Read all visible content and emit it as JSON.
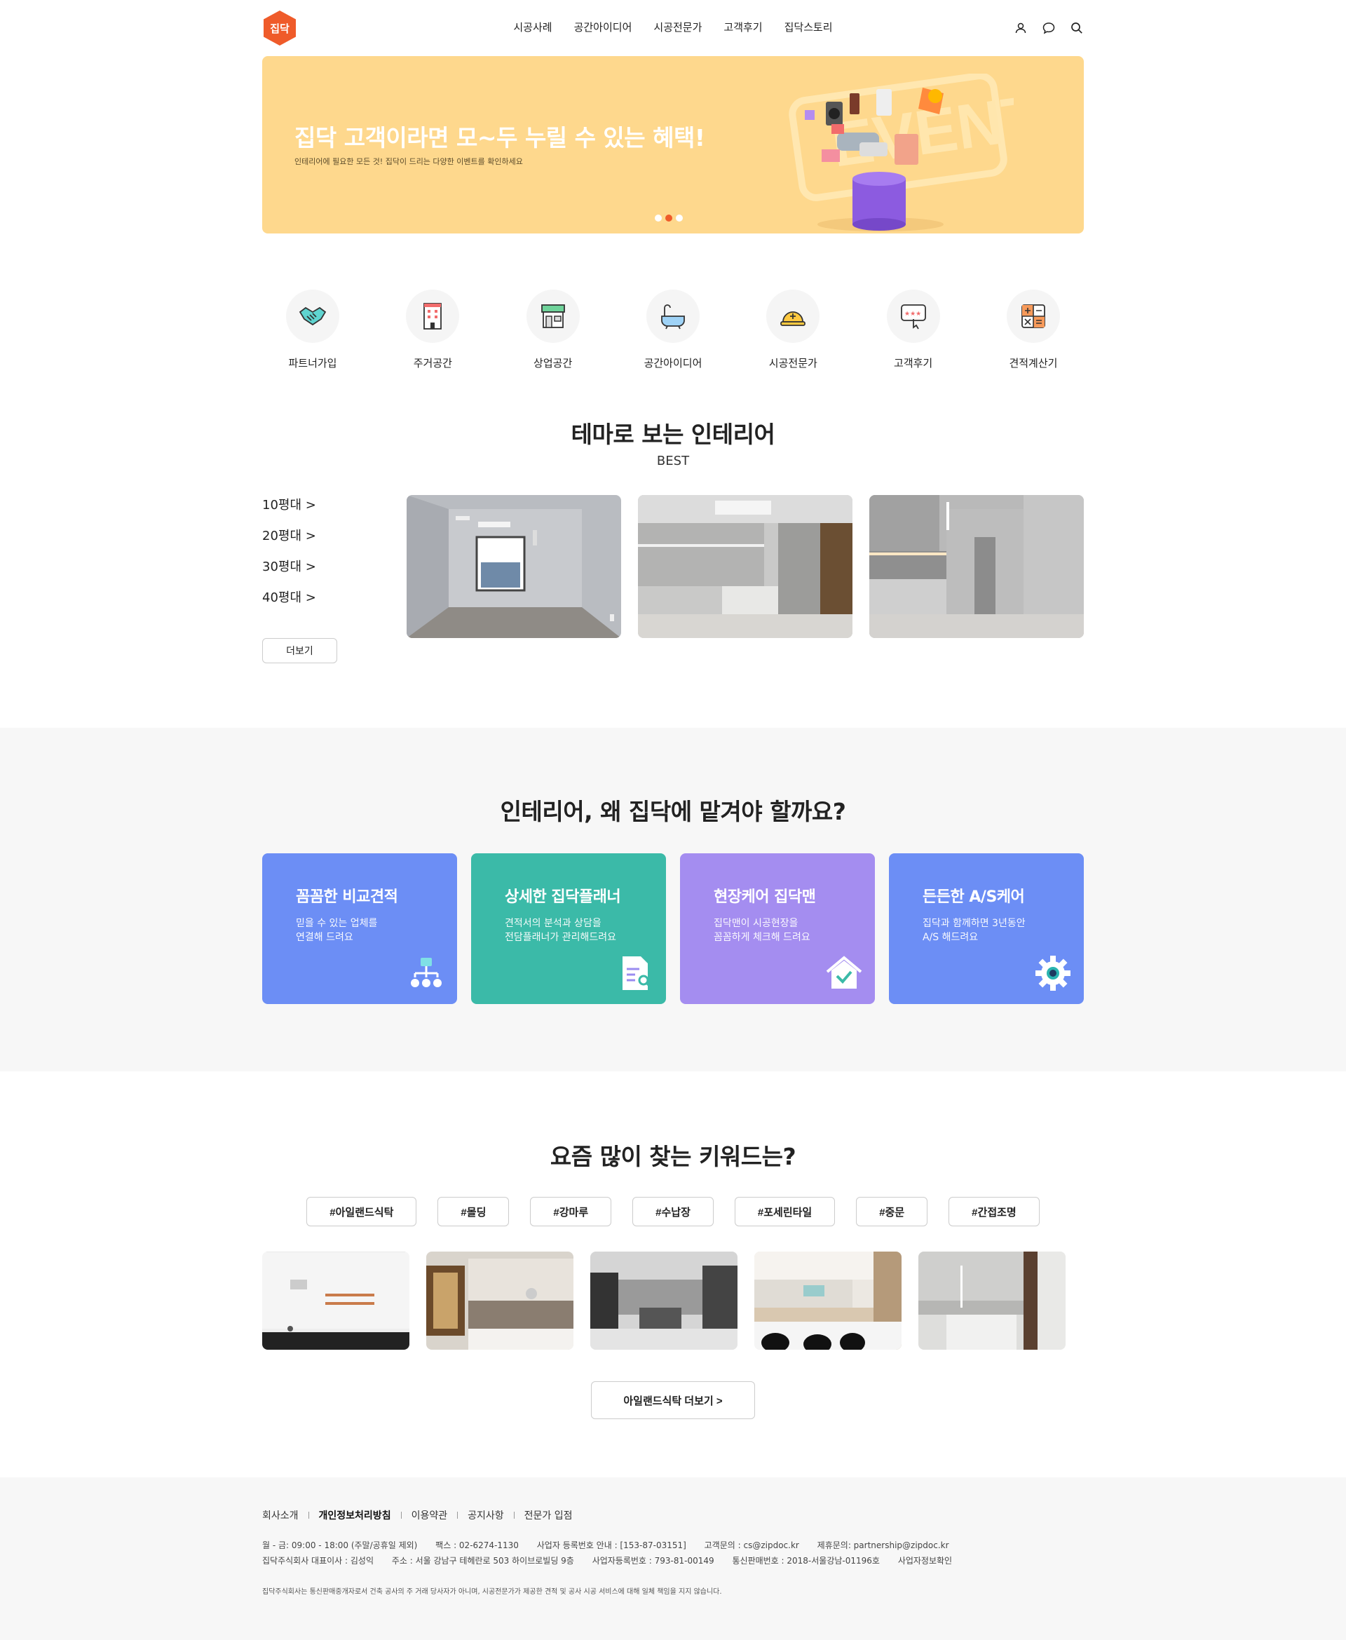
{
  "header": {
    "logo_text": "집닥",
    "nav": [
      "시공사례",
      "공간아이디어",
      "시공전문가",
      "고객후기",
      "집닥스토리"
    ],
    "icons": [
      "user-icon",
      "chat-icon",
      "search-icon"
    ]
  },
  "banner": {
    "title": "집닥 고객이라면 모~두 누릴 수 있는 혜택!",
    "subtitle": "인테리어에 필요한 모든 것! 집닥이 드리는 다양한 이벤트를 확인하세요",
    "slide_count": 3,
    "active_slide": 2,
    "bg_color": "#fed88d"
  },
  "quick_menu": [
    {
      "label": "파트너가입",
      "icon": "handshake-icon"
    },
    {
      "label": "주거공간",
      "icon": "building-icon"
    },
    {
      "label": "상업공간",
      "icon": "store-icon"
    },
    {
      "label": "공간아이디어",
      "icon": "bathtub-icon"
    },
    {
      "label": "시공전문가",
      "icon": "helmet-icon"
    },
    {
      "label": "고객후기",
      "icon": "review-icon"
    },
    {
      "label": "견적계산기",
      "icon": "calculator-icon"
    }
  ],
  "theme": {
    "title": "테마로 보는 인테리어",
    "subtitle": "BEST",
    "sizes": [
      "10평대 >",
      "20평대 >",
      "30평대 >",
      "40평대 >"
    ],
    "more_label": "더보기"
  },
  "why": {
    "title": "인테리어, 왜 집닥에 맡겨야 할까요?",
    "cards": [
      {
        "title": "꼼꼼한 비교견적",
        "line1": "믿을 수 있는 업체를",
        "line2": "연결해 드려요",
        "color": "#6c8ef5",
        "icon": "org-chart-icon"
      },
      {
        "title": "상세한 집닥플래너",
        "line1": "견적서의 분석과 상담을",
        "line2": "전담플래너가 관리해드려요",
        "color": "#3bbaa8",
        "icon": "document-search-icon"
      },
      {
        "title": "현장케어 집닥맨",
        "line1": "집닥맨이 시공현장을",
        "line2": "꼼꼼하게 체크해 드려요",
        "color": "#a48df0",
        "icon": "house-check-icon"
      },
      {
        "title": "든든한 A/S케어",
        "line1": "집닥과 함께하면 3년동안",
        "line2": "A/S 해드려요",
        "color": "#6c8ef5",
        "icon": "gear-icon"
      }
    ]
  },
  "keywords": {
    "title": "요즘 많이 찾는 키워드는?",
    "tags": [
      "#아일랜드식탁",
      "#몰딩",
      "#강마루",
      "#수납장",
      "#포세린타일",
      "#중문",
      "#간접조명"
    ],
    "more_label": "아일랜드식탁 더보기 >"
  },
  "footer": {
    "links": [
      "회사소개",
      "개인정보처리방침",
      "이용약관",
      "공지사항",
      "전문가 입점"
    ],
    "info_line1": [
      "월 - 금: 09:00 - 18:00 (주말/공휴일 제외)",
      "팩스 : 02-6274-1130",
      "사업자 등록번호 안내 : [153-87-03151]",
      "고객문의 : cs@zipdoc.kr",
      "제휴문의: partnership@zipdoc.kr"
    ],
    "info_line2": [
      "집닥주식회사 대표이사 : 김성익",
      "주소 : 서울 강남구 테헤란로 503 하이브로빌딩 9층",
      "사업자등록번호 : 793-81-00149",
      "통신판매번호 : 2018-서울강남-01196호",
      "사업자정보확인"
    ],
    "notice": "집닥주식회사는 통신판매중개자로서 건축 공사의 주 거래 당사자가 아니며, 시공전문가가 제공한 견적 및 공사 시공 서비스에 대해 일체 책임을 지지 않습니다."
  }
}
